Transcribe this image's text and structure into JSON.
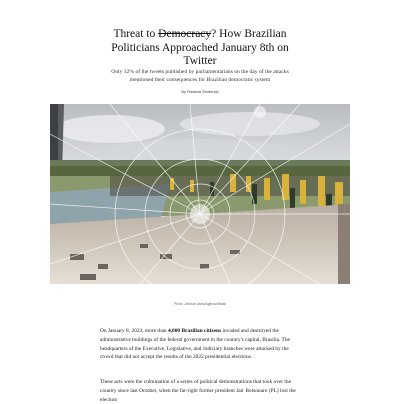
{
  "article": {
    "title_prefix": "Threat to ",
    "title_struck": "Democracy",
    "title_suffix": "? How Brazilian Politicians Approached January 8th on Twitter",
    "subtitle": "Only 32% of the tweets published by parliamentarians on the day of the attacks mentioned their consequences for Brazilian democratic system",
    "byline": "By Rafaela Sinderski",
    "image_caption": "Photo: Joédson Alves/Agência Brasil",
    "paragraph1": {
      "text_a": "On January 8, 2023, more than ",
      "bold": "4,000 Brazilian citizens",
      "text_b": " invaded and destroyed the administrative buildings of the federal government in the country's capital, Brasília. The headquarters of the Executive, Legislative, and Judiciary branches were attacked by the crowd that did not accept the results of the 2022 presidential elections."
    },
    "paragraph2": {
      "text": "These acts were the culmination of a series of political demonstrations that took over the country since last October, when the far-right former president Jair Bolsonaro (PL) lost the election"
    }
  },
  "colors": {
    "text": "#1a1a1a",
    "sky": "#c9ccd0",
    "crowd_yellow": "#d8b23a",
    "glass": "#ffffff"
  }
}
